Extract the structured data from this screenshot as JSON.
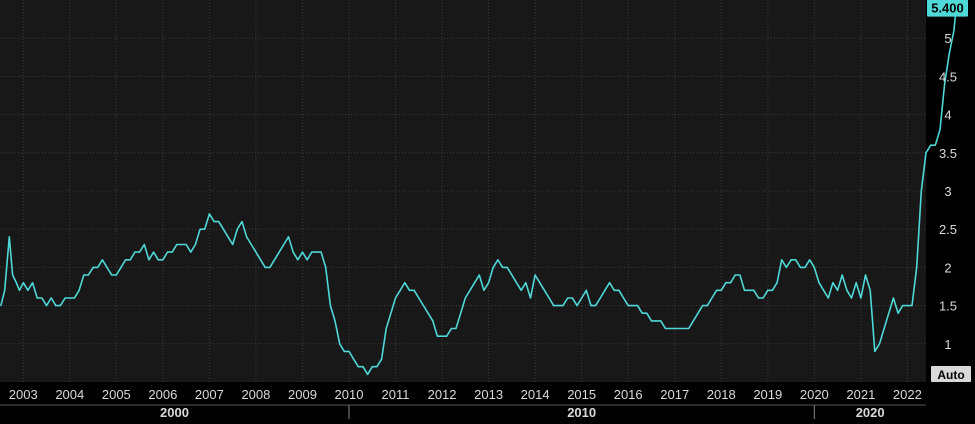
{
  "colors": {
    "background": "#000000",
    "plot_background": "#181818",
    "grid": "#3c3c3c",
    "line": "#4fd8d8",
    "axis_text": "#d9d9d9",
    "last_label_bg": "#4fd8d8",
    "last_label_text": "#000000",
    "auto_bg": "#d9d9d9",
    "auto_text": "#000000"
  },
  "controls": {
    "auto_label": "Auto"
  },
  "chart_data": {
    "type": "line",
    "title": "",
    "xlabel": "",
    "ylabel": "",
    "x_unit": "year",
    "xlim": [
      2002.5,
      2022.4
    ],
    "ylim": [
      0.5,
      5.5
    ],
    "grid": true,
    "y_axis_position": "right",
    "y_ticks": [
      1,
      1.5,
      2,
      2.5,
      3,
      3.5,
      4,
      4.5,
      5
    ],
    "y_tick_labels": [
      "1",
      "1.5",
      "2",
      "2.5",
      "3",
      "3.5",
      "4",
      "4.5",
      "5"
    ],
    "x_ticks": [
      2003,
      2004,
      2005,
      2006,
      2007,
      2008,
      2009,
      2010,
      2011,
      2012,
      2013,
      2014,
      2015,
      2016,
      2017,
      2018,
      2019,
      2020,
      2021,
      2022
    ],
    "x_tick_labels": [
      "2003",
      "2004",
      "2005",
      "2006",
      "2007",
      "2008",
      "2009",
      "2010",
      "2011",
      "2012",
      "2013",
      "2014",
      "2015",
      "2016",
      "2017",
      "2018",
      "2019",
      "2020",
      "2021",
      "2022"
    ],
    "decades": [
      {
        "label": "2000",
        "from": 2002.5,
        "to": 2010.0
      },
      {
        "label": "2010",
        "from": 2010.0,
        "to": 2020.0
      },
      {
        "label": "2020",
        "from": 2020.0,
        "to": 2022.4
      }
    ],
    "last_value_label": "5.400",
    "series": [
      {
        "points": [
          [
            2002.52,
            1.5
          ],
          [
            2002.6,
            1.7
          ],
          [
            2002.7,
            2.4
          ],
          [
            2002.77,
            1.9
          ],
          [
            2002.85,
            1.8
          ],
          [
            2002.92,
            1.7
          ],
          [
            2003.0,
            1.8
          ],
          [
            2003.1,
            1.7
          ],
          [
            2003.2,
            1.8
          ],
          [
            2003.3,
            1.6
          ],
          [
            2003.4,
            1.6
          ],
          [
            2003.5,
            1.5
          ],
          [
            2003.6,
            1.6
          ],
          [
            2003.7,
            1.5
          ],
          [
            2003.8,
            1.5
          ],
          [
            2003.9,
            1.6
          ],
          [
            2004.0,
            1.6
          ],
          [
            2004.1,
            1.6
          ],
          [
            2004.2,
            1.7
          ],
          [
            2004.3,
            1.9
          ],
          [
            2004.4,
            1.9
          ],
          [
            2004.5,
            2.0
          ],
          [
            2004.6,
            2.0
          ],
          [
            2004.7,
            2.1
          ],
          [
            2004.8,
            2.0
          ],
          [
            2004.9,
            1.9
          ],
          [
            2005.0,
            1.9
          ],
          [
            2005.1,
            2.0
          ],
          [
            2005.2,
            2.1
          ],
          [
            2005.3,
            2.1
          ],
          [
            2005.4,
            2.2
          ],
          [
            2005.5,
            2.2
          ],
          [
            2005.6,
            2.3
          ],
          [
            2005.7,
            2.1
          ],
          [
            2005.8,
            2.2
          ],
          [
            2005.9,
            2.1
          ],
          [
            2006.0,
            2.1
          ],
          [
            2006.1,
            2.2
          ],
          [
            2006.2,
            2.2
          ],
          [
            2006.3,
            2.3
          ],
          [
            2006.4,
            2.3
          ],
          [
            2006.5,
            2.3
          ],
          [
            2006.6,
            2.2
          ],
          [
            2006.7,
            2.3
          ],
          [
            2006.8,
            2.5
          ],
          [
            2006.9,
            2.5
          ],
          [
            2007.0,
            2.7
          ],
          [
            2007.1,
            2.6
          ],
          [
            2007.2,
            2.6
          ],
          [
            2007.3,
            2.5
          ],
          [
            2007.4,
            2.4
          ],
          [
            2007.5,
            2.3
          ],
          [
            2007.6,
            2.5
          ],
          [
            2007.7,
            2.6
          ],
          [
            2007.8,
            2.4
          ],
          [
            2007.9,
            2.3
          ],
          [
            2008.0,
            2.2
          ],
          [
            2008.1,
            2.1
          ],
          [
            2008.2,
            2.0
          ],
          [
            2008.3,
            2.0
          ],
          [
            2008.4,
            2.1
          ],
          [
            2008.5,
            2.2
          ],
          [
            2008.6,
            2.3
          ],
          [
            2008.7,
            2.4
          ],
          [
            2008.8,
            2.2
          ],
          [
            2008.9,
            2.1
          ],
          [
            2009.0,
            2.2
          ],
          [
            2009.1,
            2.1
          ],
          [
            2009.2,
            2.2
          ],
          [
            2009.3,
            2.2
          ],
          [
            2009.4,
            2.2
          ],
          [
            2009.5,
            2.0
          ],
          [
            2009.6,
            1.5
          ],
          [
            2009.7,
            1.3
          ],
          [
            2009.8,
            1.0
          ],
          [
            2009.9,
            0.9
          ],
          [
            2010.0,
            0.9
          ],
          [
            2010.1,
            0.8
          ],
          [
            2010.2,
            0.7
          ],
          [
            2010.3,
            0.7
          ],
          [
            2010.4,
            0.6
          ],
          [
            2010.5,
            0.7
          ],
          [
            2010.6,
            0.7
          ],
          [
            2010.7,
            0.8
          ],
          [
            2010.8,
            1.2
          ],
          [
            2010.9,
            1.4
          ],
          [
            2011.0,
            1.6
          ],
          [
            2011.1,
            1.7
          ],
          [
            2011.2,
            1.8
          ],
          [
            2011.3,
            1.7
          ],
          [
            2011.4,
            1.7
          ],
          [
            2011.5,
            1.6
          ],
          [
            2011.6,
            1.5
          ],
          [
            2011.7,
            1.4
          ],
          [
            2011.8,
            1.3
          ],
          [
            2011.9,
            1.1
          ],
          [
            2012.0,
            1.1
          ],
          [
            2012.1,
            1.1
          ],
          [
            2012.2,
            1.2
          ],
          [
            2012.3,
            1.2
          ],
          [
            2012.4,
            1.4
          ],
          [
            2012.5,
            1.6
          ],
          [
            2012.6,
            1.7
          ],
          [
            2012.7,
            1.8
          ],
          [
            2012.8,
            1.9
          ],
          [
            2012.9,
            1.7
          ],
          [
            2013.0,
            1.8
          ],
          [
            2013.1,
            2.0
          ],
          [
            2013.2,
            2.1
          ],
          [
            2013.3,
            2.0
          ],
          [
            2013.4,
            2.0
          ],
          [
            2013.5,
            1.9
          ],
          [
            2013.6,
            1.8
          ],
          [
            2013.7,
            1.7
          ],
          [
            2013.8,
            1.8
          ],
          [
            2013.9,
            1.6
          ],
          [
            2014.0,
            1.9
          ],
          [
            2014.1,
            1.8
          ],
          [
            2014.2,
            1.7
          ],
          [
            2014.3,
            1.6
          ],
          [
            2014.4,
            1.5
          ],
          [
            2014.5,
            1.5
          ],
          [
            2014.6,
            1.5
          ],
          [
            2014.7,
            1.6
          ],
          [
            2014.8,
            1.6
          ],
          [
            2014.9,
            1.5
          ],
          [
            2015.0,
            1.6
          ],
          [
            2015.1,
            1.7
          ],
          [
            2015.2,
            1.5
          ],
          [
            2015.3,
            1.5
          ],
          [
            2015.4,
            1.6
          ],
          [
            2015.5,
            1.7
          ],
          [
            2015.6,
            1.8
          ],
          [
            2015.7,
            1.7
          ],
          [
            2015.8,
            1.7
          ],
          [
            2015.9,
            1.6
          ],
          [
            2016.0,
            1.5
          ],
          [
            2016.1,
            1.5
          ],
          [
            2016.2,
            1.5
          ],
          [
            2016.3,
            1.4
          ],
          [
            2016.4,
            1.4
          ],
          [
            2016.5,
            1.3
          ],
          [
            2016.6,
            1.3
          ],
          [
            2016.7,
            1.3
          ],
          [
            2016.8,
            1.2
          ],
          [
            2016.9,
            1.2
          ],
          [
            2017.0,
            1.2
          ],
          [
            2017.1,
            1.2
          ],
          [
            2017.2,
            1.2
          ],
          [
            2017.3,
            1.2
          ],
          [
            2017.4,
            1.3
          ],
          [
            2017.5,
            1.4
          ],
          [
            2017.6,
            1.5
          ],
          [
            2017.7,
            1.5
          ],
          [
            2017.8,
            1.6
          ],
          [
            2017.9,
            1.7
          ],
          [
            2018.0,
            1.7
          ],
          [
            2018.1,
            1.8
          ],
          [
            2018.2,
            1.8
          ],
          [
            2018.3,
            1.9
          ],
          [
            2018.4,
            1.9
          ],
          [
            2018.5,
            1.7
          ],
          [
            2018.6,
            1.7
          ],
          [
            2018.7,
            1.7
          ],
          [
            2018.8,
            1.6
          ],
          [
            2018.9,
            1.6
          ],
          [
            2019.0,
            1.7
          ],
          [
            2019.1,
            1.7
          ],
          [
            2019.2,
            1.8
          ],
          [
            2019.3,
            2.1
          ],
          [
            2019.4,
            2.0
          ],
          [
            2019.5,
            2.1
          ],
          [
            2019.6,
            2.1
          ],
          [
            2019.7,
            2.0
          ],
          [
            2019.8,
            2.0
          ],
          [
            2019.9,
            2.1
          ],
          [
            2020.0,
            2.0
          ],
          [
            2020.1,
            1.8
          ],
          [
            2020.2,
            1.7
          ],
          [
            2020.3,
            1.6
          ],
          [
            2020.4,
            1.8
          ],
          [
            2020.5,
            1.7
          ],
          [
            2020.6,
            1.9
          ],
          [
            2020.7,
            1.7
          ],
          [
            2020.8,
            1.6
          ],
          [
            2020.9,
            1.8
          ],
          [
            2021.0,
            1.6
          ],
          [
            2021.1,
            1.9
          ],
          [
            2021.2,
            1.7
          ],
          [
            2021.3,
            0.9
          ],
          [
            2021.4,
            1.0
          ],
          [
            2021.5,
            1.2
          ],
          [
            2021.6,
            1.4
          ],
          [
            2021.7,
            1.6
          ],
          [
            2021.8,
            1.4
          ],
          [
            2021.9,
            1.5
          ],
          [
            2022.0,
            1.5
          ],
          [
            2022.1,
            1.5
          ],
          [
            2022.2,
            2.0
          ],
          [
            2022.3,
            3.0
          ],
          [
            2022.4,
            3.5
          ],
          [
            2022.5,
            3.6
          ],
          [
            2022.6,
            3.6
          ],
          [
            2022.7,
            3.8
          ],
          [
            2022.8,
            4.4
          ],
          [
            2022.9,
            4.8
          ],
          [
            2023.0,
            5.1
          ],
          [
            2023.05,
            5.4
          ]
        ]
      }
    ]
  }
}
